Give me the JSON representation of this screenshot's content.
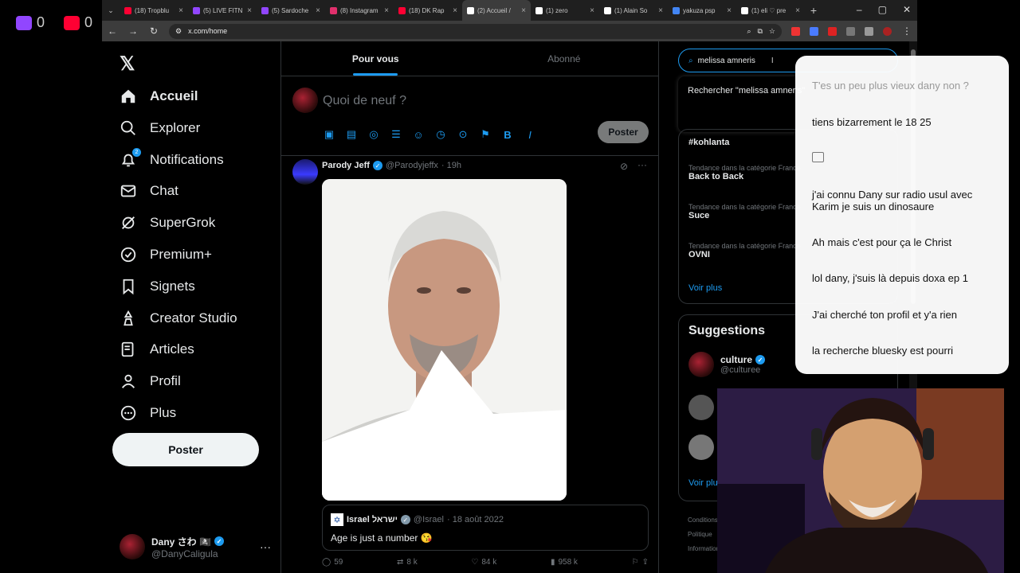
{
  "overlay": {
    "twitch_count": "0",
    "youtube_count": "0"
  },
  "browser": {
    "tabs": [
      {
        "title": "(18) Tropblu",
        "favicon_color": "#ff0033"
      },
      {
        "title": "(5) LIVE FITN",
        "favicon_color": "#9146ff"
      },
      {
        "title": "(5) Sardoche",
        "favicon_color": "#9146ff"
      },
      {
        "title": "(8) Instagram",
        "favicon_color": "#e1306c"
      },
      {
        "title": "(18) DK Rap",
        "favicon_color": "#ff0033"
      },
      {
        "title": "(2) Accueil /",
        "favicon_color": "#ffffff"
      },
      {
        "title": "(1) zero",
        "favicon_color": "#ffffff"
      },
      {
        "title": "(1) Alain So",
        "favicon_color": "#ffffff"
      },
      {
        "title": "yakuza psp",
        "favicon_color": "#4285f4"
      },
      {
        "title": "(1) eli ♡ pre",
        "favicon_color": "#ffffff"
      }
    ],
    "active_tab": 5,
    "url": "x.com/home",
    "new_tab": "+"
  },
  "nav": {
    "items": [
      {
        "label": "Accueil",
        "icon": "home-icon"
      },
      {
        "label": "Explorer",
        "icon": "search-icon"
      },
      {
        "label": "Notifications",
        "icon": "bell-icon",
        "badge": "2"
      },
      {
        "label": "Chat",
        "icon": "mail-icon"
      },
      {
        "label": "SuperGrok",
        "icon": "grok-icon"
      },
      {
        "label": "Premium+",
        "icon": "premium-icon"
      },
      {
        "label": "Signets",
        "icon": "bookmark-icon"
      },
      {
        "label": "Creator Studio",
        "icon": "creator-icon"
      },
      {
        "label": "Articles",
        "icon": "articles-icon"
      },
      {
        "label": "Profil",
        "icon": "person-icon"
      },
      {
        "label": "Plus",
        "icon": "more-circle-icon"
      }
    ],
    "post_label": "Poster",
    "account": {
      "name": "Dany さわ 🏴‍☠️",
      "handle": "@DanyCaligula"
    }
  },
  "feed": {
    "tabs": [
      "Pour vous",
      "Abonné"
    ],
    "composer_placeholder": "Quoi de neuf ?",
    "composer_post": "Poster",
    "tweet": {
      "name": "Parody Jeff",
      "handle": "@Parodyjeffx",
      "time": "· 19h",
      "quote": {
        "name": "Israel ישראל",
        "handle": "@Israel",
        "time": "· 18 août 2022",
        "text": "Age is just a number 😘"
      },
      "replies": "59",
      "reposts": "8 k",
      "likes": "84 k",
      "views": "958 k"
    }
  },
  "sidebar": {
    "search_value": "melissa amneris",
    "search_suggestion": "Rechercher \"melissa amneris\"",
    "trends": [
      {
        "category": "",
        "name": "#kohlanta"
      },
      {
        "category": "Tendance dans la catégorie France",
        "name": "Back to Back"
      },
      {
        "category": "Tendance dans la catégorie France",
        "name": "Suce"
      },
      {
        "category": "Tendance dans la catégorie France",
        "name": "OVNI"
      }
    ],
    "show_more": "Voir plus",
    "suggestions_title": "Suggestions",
    "suggestion": {
      "name": "culture",
      "handle": "@culturee"
    },
    "footer": [
      "Conditions",
      "Politique",
      "Informations"
    ]
  },
  "chat": {
    "messages": [
      "T'es un peu plus vieux dany non ?",
      "tiens bizarrement le 18 25",
      "",
      "j'ai connu Dany sur radio usul avec Karim je suis un dinosaure",
      "Ah mais c'est pour ça le Christ",
      "lol dany, j'suis là depuis doxa ep 1",
      "J'ai cherché ton profil et y'a rien",
      "la recherche bluesky est pourri"
    ]
  }
}
